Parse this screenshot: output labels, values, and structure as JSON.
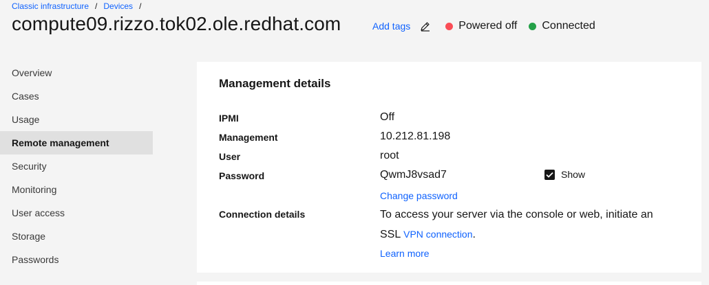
{
  "breadcrumb": {
    "items": [
      "Classic infrastructure",
      "Devices"
    ],
    "separator": "/"
  },
  "header": {
    "title": "compute09.rizzo.tok02.ole.redhat.com",
    "add_tags": "Add tags",
    "edit_icon": "edit-icon",
    "power_status": "Powered off",
    "power_color": "#fa4d56",
    "connection_status": "Connected",
    "connection_color": "#24a148"
  },
  "sidebar": {
    "items": [
      {
        "label": "Overview"
      },
      {
        "label": "Cases"
      },
      {
        "label": "Usage"
      },
      {
        "label": "Remote management",
        "active": true
      },
      {
        "label": "Security"
      },
      {
        "label": "Monitoring"
      },
      {
        "label": "User access"
      },
      {
        "label": "Storage"
      },
      {
        "label": "Passwords"
      }
    ]
  },
  "management": {
    "title": "Management details",
    "ipmi_label": "IPMI",
    "ipmi_value": "Off",
    "management_label": "Management",
    "management_value": "10.212.81.198",
    "user_label": "User",
    "user_value": "root",
    "password_label": "Password",
    "password_value": "QwmJ8vsad7",
    "show_label": "Show",
    "show_checked": true,
    "change_password": "Change password",
    "connection_label": "Connection details",
    "connection_text_before": "To access your server via the console or web, initiate an SSL",
    "vpn_link": "VPN connection",
    "connection_text_after": ".",
    "learn_more": "Learn more"
  },
  "colors": {
    "link": "#0f62fe",
    "active_nav_bg": "#e0e0e0",
    "page_bg": "#f4f4f4"
  }
}
